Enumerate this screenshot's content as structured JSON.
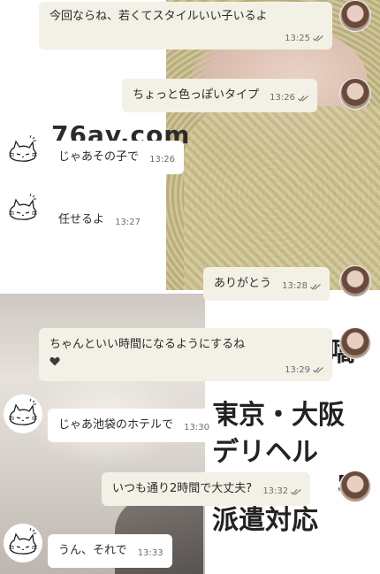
{
  "background": {
    "watermark_url": "76av.com",
    "ad_lines": [
      "東京・大阪",
      "デリヘル",
      "派遣対応"
    ],
    "ad_fragment_a": "嚆",
    "ad_fragment_b": "宅"
  },
  "messages": [
    {
      "id": "m1",
      "dir": "out",
      "text": "今回ならね、若くてスタイルいい子いるよ",
      "time": "13:25",
      "status": "read"
    },
    {
      "id": "m2",
      "dir": "out",
      "text": "ちょっと色っぽいタイプ",
      "time": "13:26",
      "status": "read"
    },
    {
      "id": "m3",
      "dir": "in",
      "text": "じゃあその子で",
      "time": "13:26"
    },
    {
      "id": "m4",
      "dir": "in",
      "text": "任せるよ",
      "time": "13:27"
    },
    {
      "id": "m5",
      "dir": "out",
      "text": "ありがとう",
      "time": "13:28",
      "status": "read"
    },
    {
      "id": "m6",
      "dir": "out",
      "text": "ちゃんといい時間になるようにするね",
      "emoji": "heart",
      "time": "13:29",
      "status": "read"
    },
    {
      "id": "m7",
      "dir": "in",
      "text": "じゃあ池袋のホテルで",
      "time": "13:30"
    },
    {
      "id": "m8",
      "dir": "out",
      "text": "いつも通り2時間で大丈夫?",
      "time": "13:32",
      "status": "read"
    },
    {
      "id": "m9",
      "dir": "in",
      "text": "うん、それで",
      "time": "13:33"
    }
  ],
  "avatars": {
    "her": "woman-avatar",
    "me": "cat-doodle-avatar"
  },
  "colors": {
    "outgoing_bubble": "#f3f0e6",
    "incoming_bubble": "#ffffff",
    "text": "#2a2a2a",
    "meta": "#6d6d6d"
  }
}
